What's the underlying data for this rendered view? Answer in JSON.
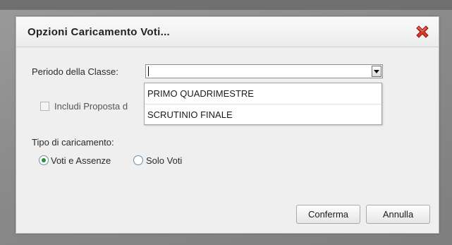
{
  "dialog": {
    "title": "Opzioni Caricamento Voti..."
  },
  "form": {
    "periodo_label": "Periodo della Classe:",
    "periodo_value": "",
    "periodo_options": [
      "PRIMO QUADRIMESTRE",
      "SCRUTINIO FINALE"
    ],
    "includi_label": "Includi Proposta d",
    "includi_checked": false,
    "tipo_label": "Tipo di caricamento:",
    "radio_voti_assenze": "Voti e Assenze",
    "radio_solo_voti": "Solo Voti",
    "selected_radio": "Voti e Assenze"
  },
  "buttons": {
    "confirm": "Conferma",
    "cancel": "Annulla"
  },
  "colors": {
    "close_icon": "#d63a2a",
    "radio_selected": "#2e8b3a"
  }
}
